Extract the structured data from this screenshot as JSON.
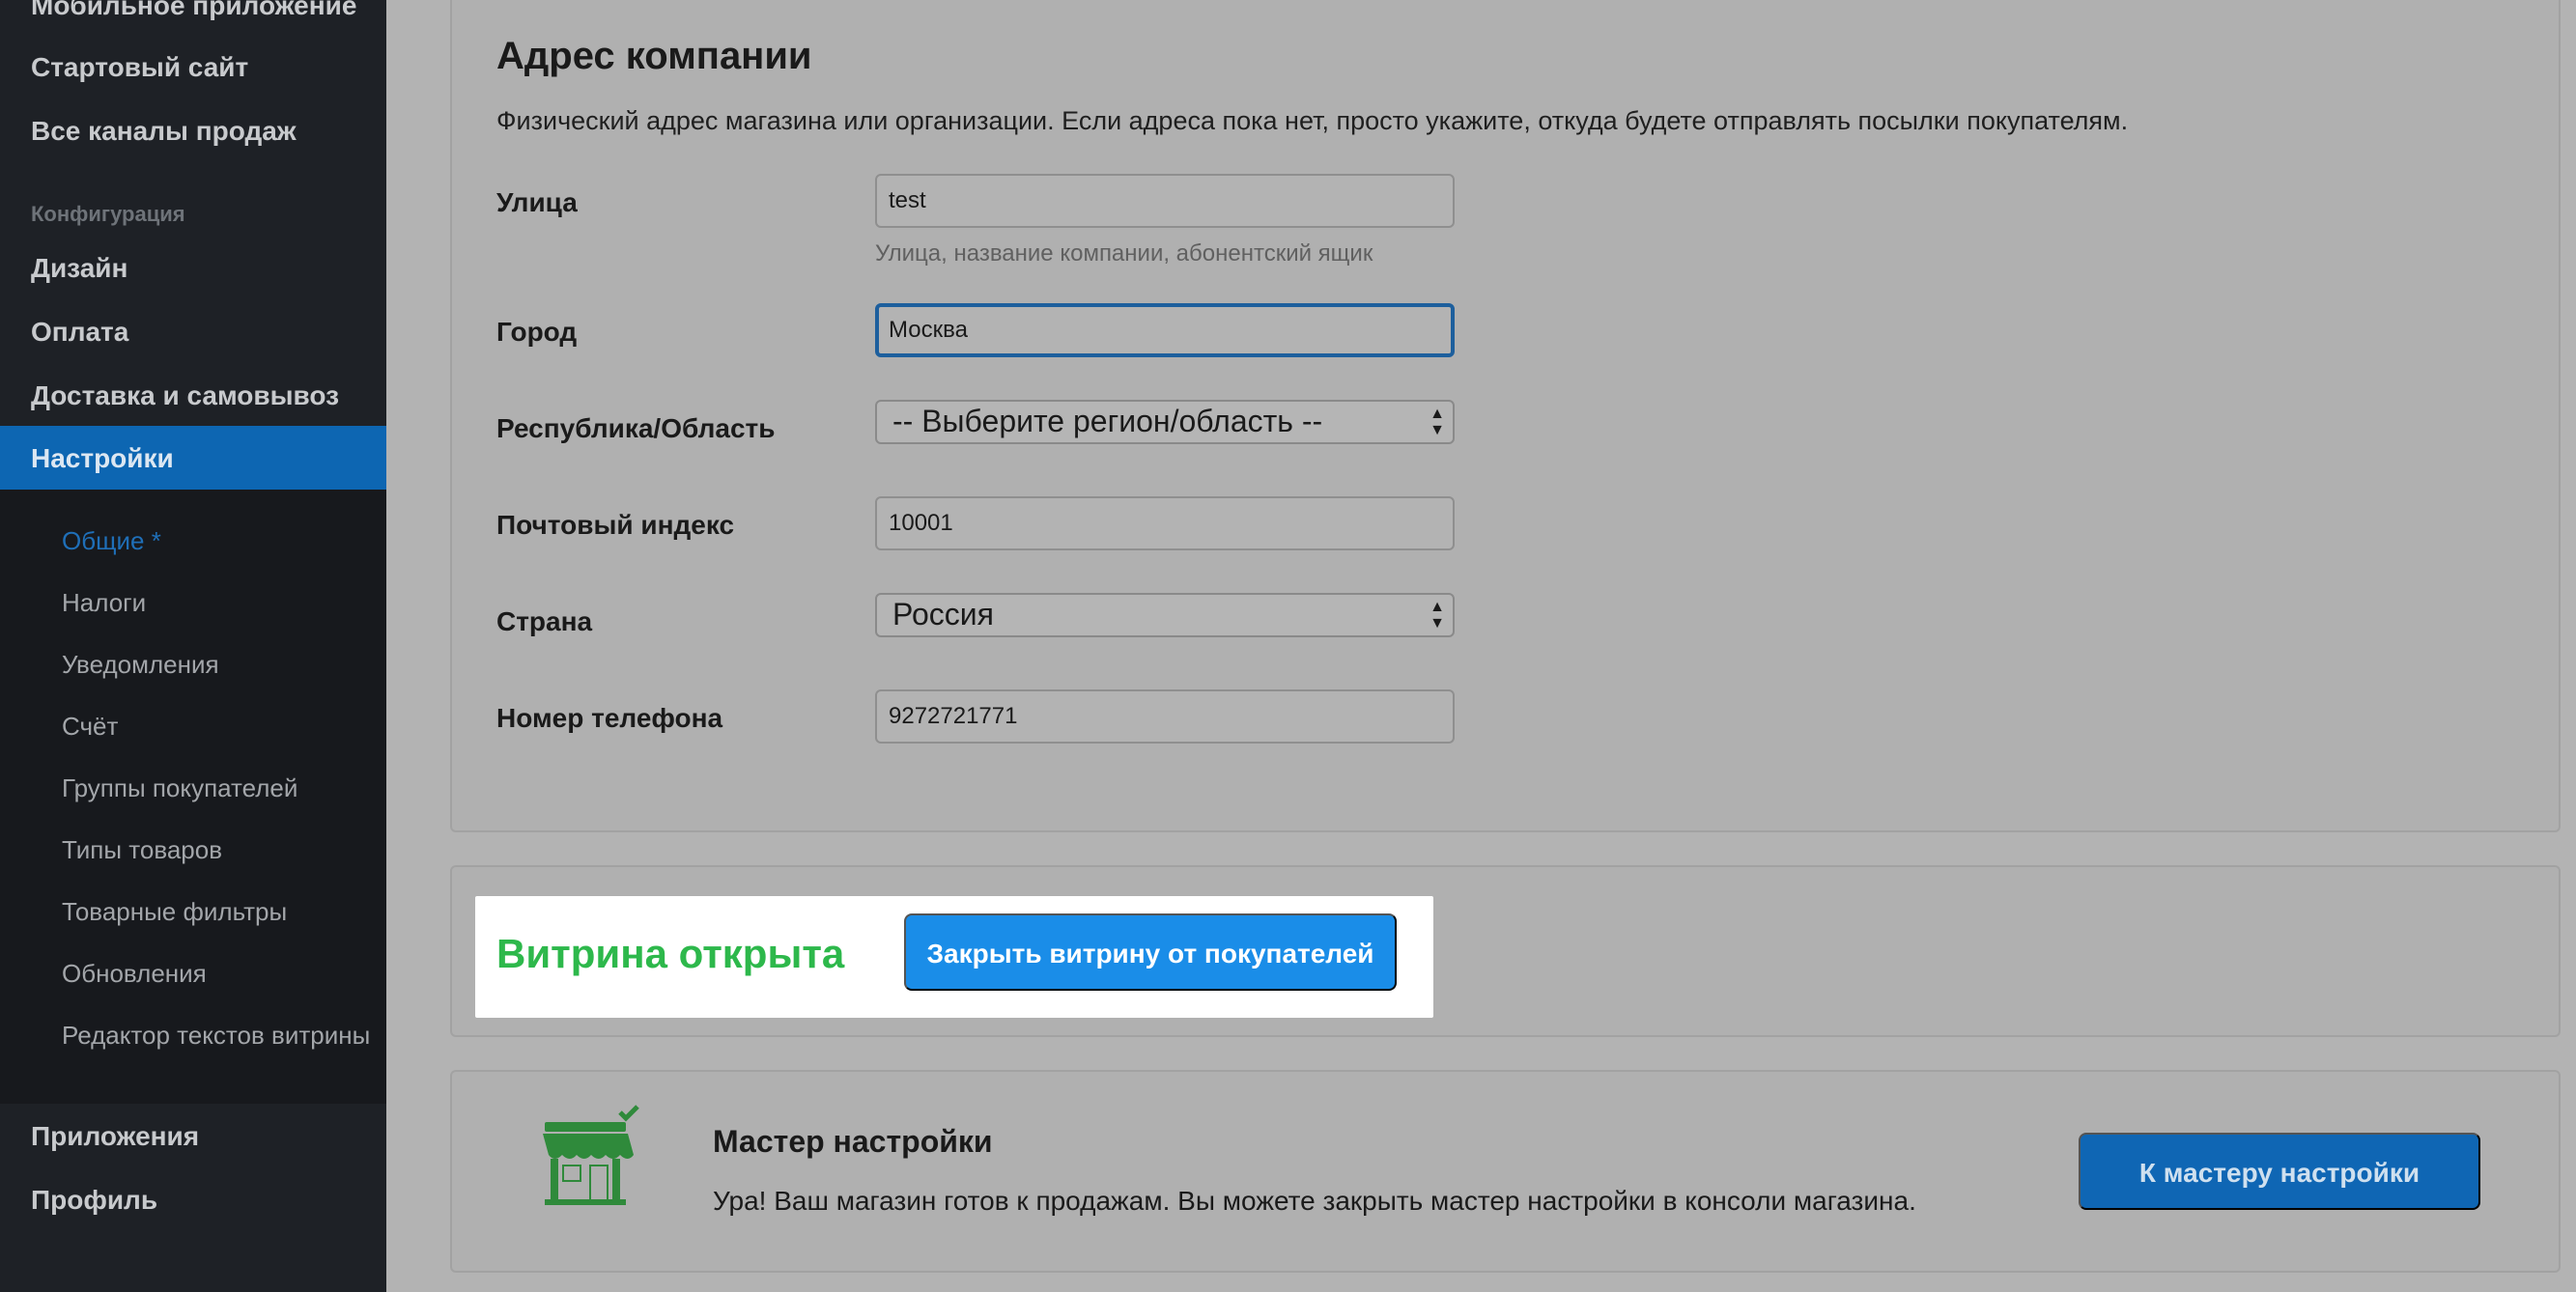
{
  "sidebar": {
    "top_items": [
      "Мобильное приложение",
      "Стартовый сайт",
      "Все каналы продаж"
    ],
    "config_section": "Конфигурация",
    "config_items": [
      "Дизайн",
      "Оплата",
      "Доставка и самовывоз"
    ],
    "active_item": "Настройки",
    "sub_items": [
      "Общие *",
      "Налоги",
      "Уведомления",
      "Счёт",
      "Группы покупателей",
      "Типы товаров",
      "Товарные фильтры",
      "Обновления",
      "Редактор текстов витрины"
    ],
    "bottom_items": [
      "Приложения",
      "Профиль"
    ]
  },
  "address": {
    "title": "Адрес компании",
    "description": "Физический адрес магазина или организации. Если адреса пока нет, просто укажите, откуда будете отправлять посылки покупателям.",
    "street_label": "Улица",
    "street_value": "test",
    "street_hint": "Улица, название компании, абонентский ящик",
    "city_label": "Город",
    "city_value": "Москва",
    "region_label": "Республика/Область",
    "region_value": "-- Выберите регион/область --",
    "zip_label": "Почтовый индекс",
    "zip_value": "10001",
    "country_label": "Страна",
    "country_value": "Россия",
    "phone_label": "Номер телефона",
    "phone_value": "9272721771"
  },
  "storefront": {
    "status": "Витрина открыта",
    "close_button": "Закрыть витрину от покупателей",
    "status_color": "#2db84b"
  },
  "wizard": {
    "title": "Мастер настройки",
    "text": "Ура! Ваш магазин готов к продажам. Вы можете закрыть мастер настройки в консоли магазина.",
    "button": "К мастеру настройки"
  },
  "colors": {
    "accent": "#1a8de8",
    "sidebar_bg": "#1e2126",
    "active_nav": "#0d66b2"
  }
}
